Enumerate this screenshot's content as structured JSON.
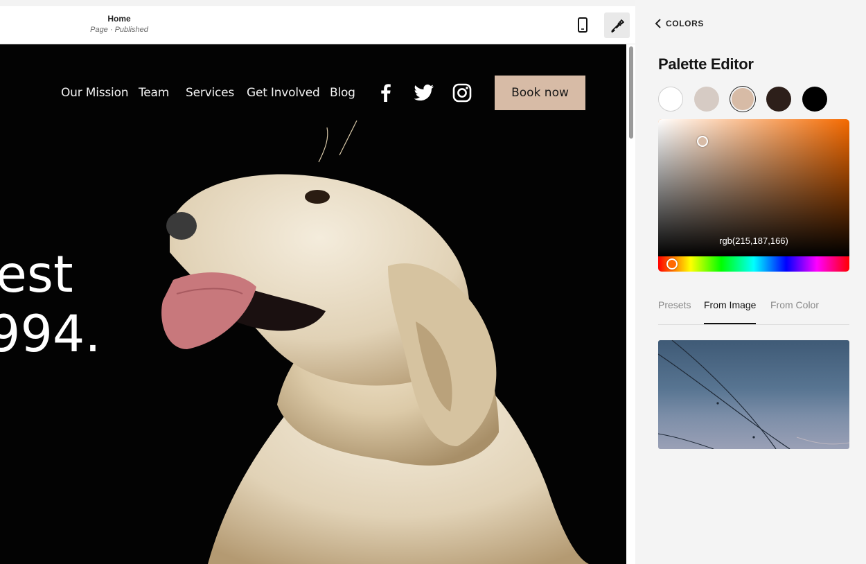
{
  "topbar": {
    "page_title": "Home",
    "page_status": "Page · Published"
  },
  "icons": {
    "mobile": "mobile-phone-icon",
    "design": "paintbrush-icon",
    "back": "chevron-left-icon",
    "facebook": "facebook-icon",
    "twitter": "twitter-icon",
    "instagram": "instagram-icon"
  },
  "site": {
    "nav": [
      "Our Mission",
      "Team",
      "Services",
      "Get Involved",
      "Blog"
    ],
    "cta": "Book now",
    "hero_line1": "est",
    "hero_line2": "994."
  },
  "panel": {
    "back_label": "COLORS",
    "title": "Palette Editor",
    "swatches": [
      "#ffffff",
      "#d6cbc4",
      "#d7bba6",
      "#2d1f1a",
      "#000000"
    ],
    "selected_swatch": 2,
    "rgb_value": "rgb(215,187,166)",
    "tabs": [
      "Presets",
      "From Image",
      "From Color"
    ],
    "active_tab": 1
  },
  "colors": {
    "accent": "#d7bba6",
    "hue_base": "#f56a00"
  }
}
